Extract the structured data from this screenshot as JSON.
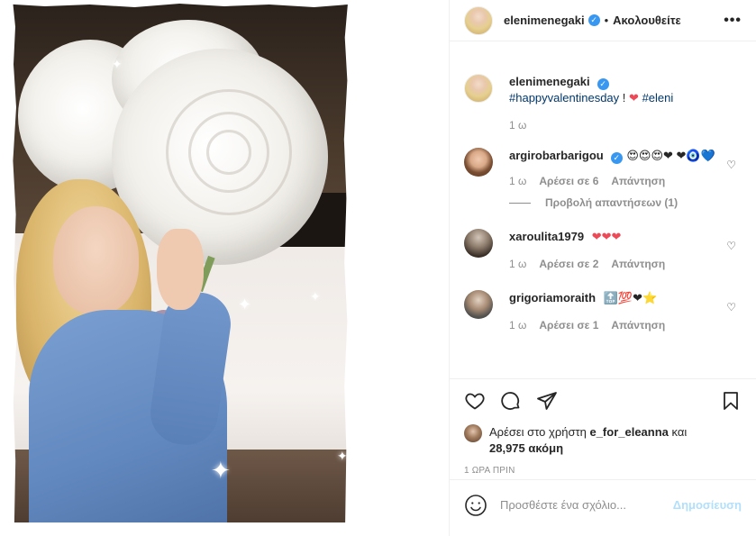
{
  "post": {
    "author": "elenimenegaki",
    "follow_label": "Ακολουθείτε",
    "separator": "•",
    "more_label": "•••"
  },
  "caption": {
    "username": "elenimenegaki",
    "hashtag1": "#happyvalentinesday",
    "exclaim": "!",
    "heart": "❤",
    "hashtag2": "#eleni",
    "time": "1 ω"
  },
  "comments": [
    {
      "username": "argirobarbarigou",
      "verified": true,
      "emojis": "😍😍😍❤ ❤🧿💙",
      "time": "1 ω",
      "likes": "Αρέσει σε 6",
      "reply": "Απάντηση"
    },
    {
      "username": "xaroulita1979",
      "verified": false,
      "emojis": "❤❤❤",
      "time": "1 ω",
      "likes": "Αρέσει σε 2",
      "reply": "Απάντηση"
    },
    {
      "username": "grigoriamoraith",
      "verified": false,
      "emojis": "🔝💯❤⭐",
      "time": "1 ω",
      "likes": "Αρέσει σε 1",
      "reply": "Απάντηση"
    }
  ],
  "view_replies": "Προβολή απαντήσεων (1)",
  "likes": {
    "prefix": "Αρέσει στο χρήστη",
    "user": "e_for_eleanna",
    "mid": "και",
    "count": "28,975 ακόμη"
  },
  "timestamp": "1 ΩΡΑ ΠΡΙΝ",
  "composer": {
    "placeholder": "Προσθέστε ένα σχόλιο...",
    "post_label": "Δημοσίευση"
  },
  "colors": {
    "verified": "#3897f0",
    "heart": "#ed4956",
    "link": "#00376b",
    "post_disabled": "#b2dffc"
  }
}
